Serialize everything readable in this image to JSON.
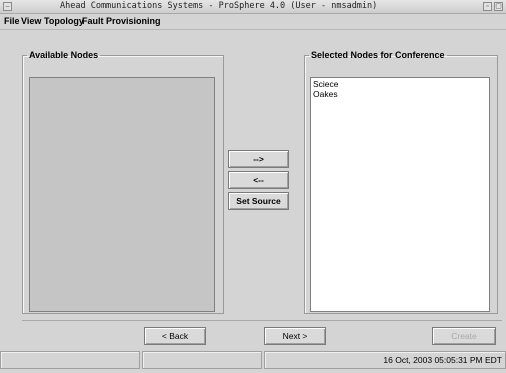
{
  "window": {
    "title": "Ahead Communications Systems - ProSphere 4.0 (User - nmsadmin)"
  },
  "menu": [
    {
      "label": "File"
    },
    {
      "label": "View"
    },
    {
      "label": "Topology"
    },
    {
      "label": "Fault"
    },
    {
      "label": "Provisioning"
    }
  ],
  "available_nodes": {
    "legend": "Available Nodes",
    "items": []
  },
  "selected_nodes": {
    "legend": "Selected Nodes for Conference",
    "items": [
      "Sciece",
      "Oakes"
    ]
  },
  "transfer_buttons": {
    "add_label": "-->",
    "remove_label": "<--",
    "set_source_label": "Set Source"
  },
  "wizard": {
    "back_label": "< Back",
    "next_label": "Next >",
    "create_label": "Create"
  },
  "status": {
    "cell1": "",
    "cell2": "",
    "datetime": "16 Oct, 2003 05:05:31 PM EDT"
  },
  "icons": [
    "window-menu-icon",
    "minimize-icon",
    "maximize-icon"
  ]
}
